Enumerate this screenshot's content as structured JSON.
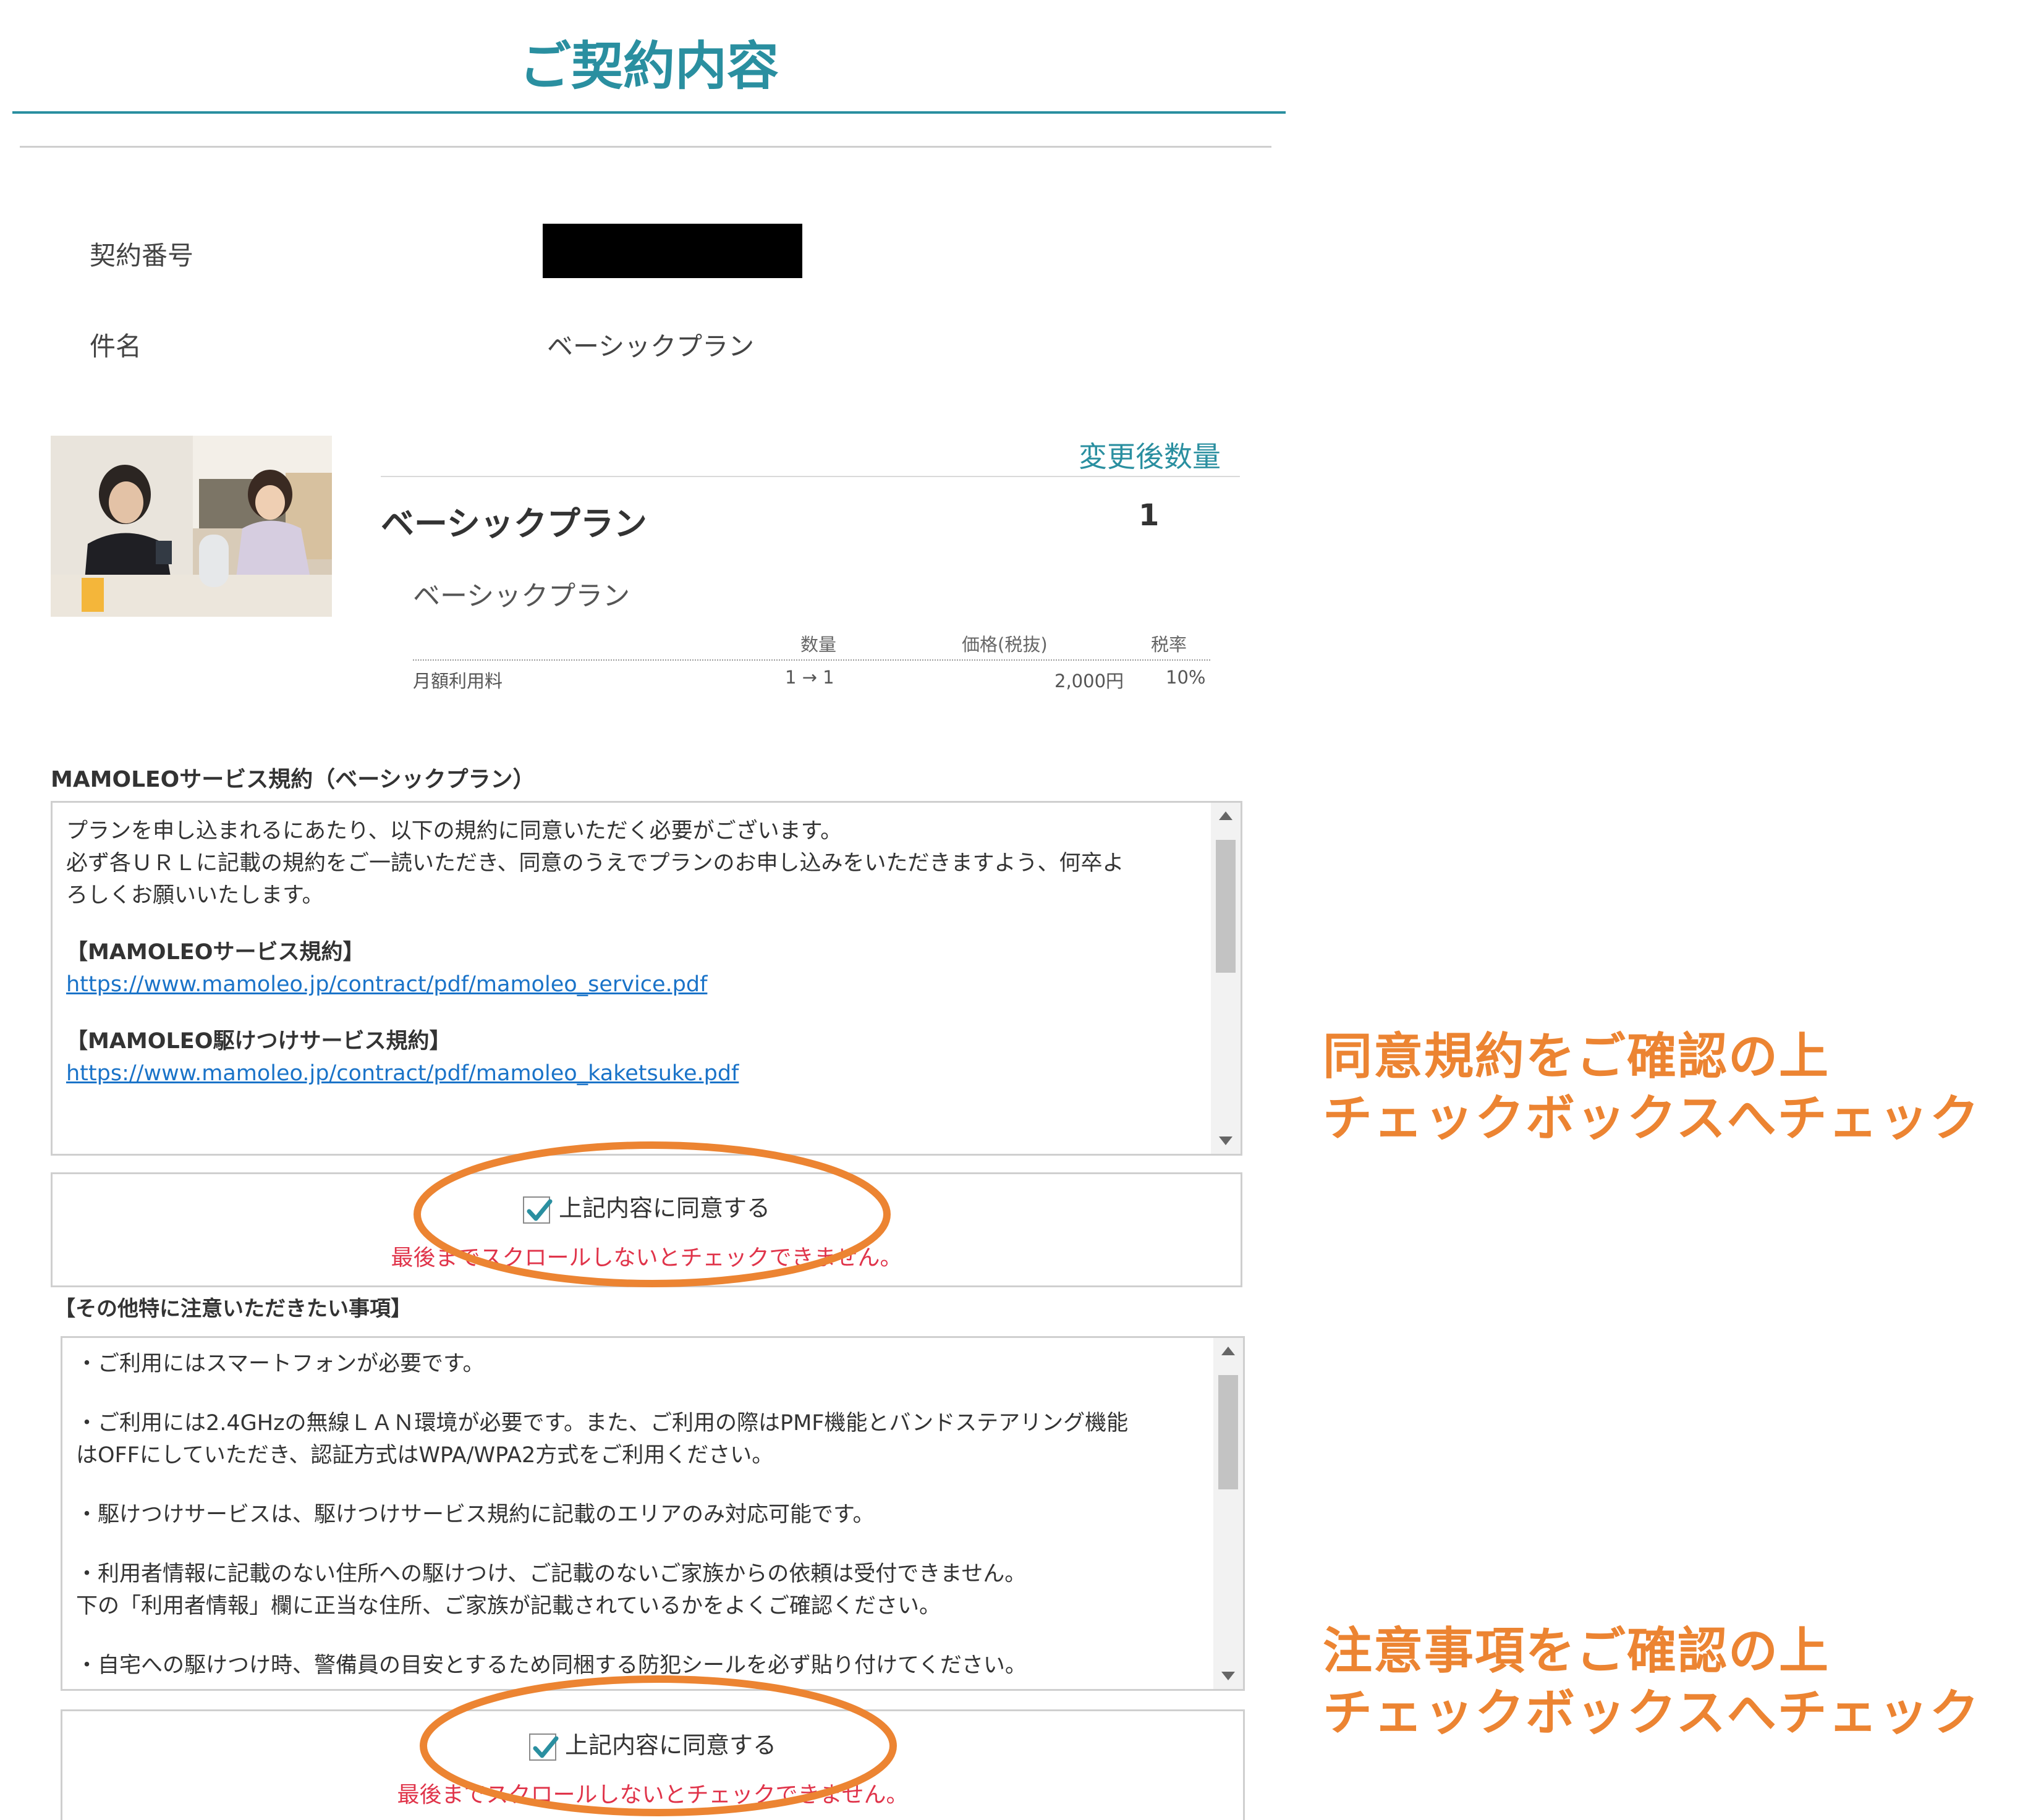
{
  "header": {
    "title": "ご契約内容"
  },
  "contract": {
    "number_label": "契約番号",
    "subject_label": "件名",
    "subject_value": "ベーシックプラン"
  },
  "product": {
    "qty_header": "変更後数量",
    "name": "ベーシックプラン",
    "quantity": "1",
    "sub_name": "ベーシックプラン",
    "fees": {
      "headers": {
        "qty": "数量",
        "price": "価格(税抜)",
        "tax": "税率"
      },
      "rows": [
        {
          "name": "月額利用料",
          "qty": "1 → 1",
          "price": "2,000円",
          "tax": "10%"
        }
      ]
    }
  },
  "terms": {
    "heading": "MAMOLEOサービス規約（ベーシックプラン）",
    "intro_1": "プランを申し込まれるにあたり、以下の規約に同意いただく必要がございます。",
    "intro_2": "必ず各ＵＲＬに記載の規約をご一読いただき、同意のうえでプランのお申し込みをいただきますよう、何卒よ",
    "intro_3": "ろしくお願いいたします。",
    "service_title": "【MAMOLEOサービス規約】",
    "service_url": "https://www.mamoleo.jp/contract/pdf/mamoleo_service.pdf",
    "kaketsuke_title": "【MAMOLEO駆けつけサービス規約】",
    "kaketsuke_url": "https://www.mamoleo.jp/contract/pdf/mamoleo_kaketsuke.pdf",
    "agree_label": "上記内容に同意する",
    "agree_checked": true,
    "scroll_note": "最後までスクロールしないとチェックできません。"
  },
  "notices": {
    "heading": "【その他特に注意いただきたい事項】",
    "line_1": "・ご利用にはスマートフォンが必要です。",
    "line_2a": "・ご利用には2.4GHzの無線ＬＡＮ環境が必要です。また、ご利用の際はPMF機能とバンドステアリング機能",
    "line_2b": "はOFFにしていただき、認証方式はWPA/WPA2方式をご利用ください。",
    "line_3": "・駆けつけサービスは、駆けつけサービス規約に記載のエリアのみ対応可能です。",
    "line_4a": "・利用者情報に記載のない住所への駆けつけ、ご記載のないご家族からの依頼は受付できません。",
    "line_4b": "下の「利用者情報」欄に正当な住所、ご家族が記載されているかをよくご確認ください。",
    "line_5": "・自宅への駆けつけ時、警備員の目安とするため同梱する防犯シールを必ず貼り付けてください。",
    "agree_label": "上記内容に同意する",
    "agree_checked": true,
    "scroll_note": "最後までスクロールしないとチェックできません。"
  },
  "callouts": {
    "terms_line_1": "同意規約をご確認の上",
    "terms_line_2": "チェックボックスへチェック",
    "notices_line_1": "注意事項をご確認の上",
    "notices_line_2": "チェックボックスへチェック"
  },
  "colors": {
    "accent": "#2a8fa0",
    "annotation": "#ec8432",
    "warning": "#e0344a",
    "link": "#1a73c8"
  }
}
